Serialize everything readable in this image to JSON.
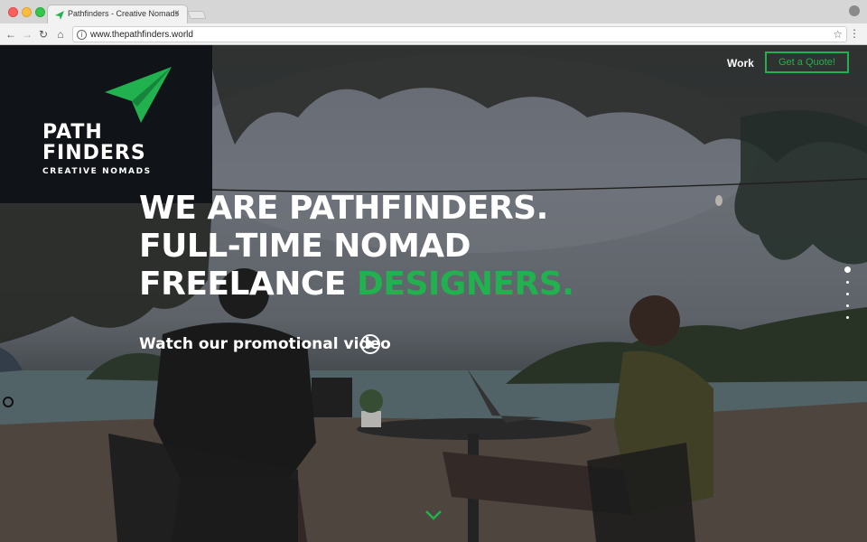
{
  "browser": {
    "tab_title": "Pathfinders - Creative Nomads",
    "tab_close": "×",
    "url": "www.thepathfinders.world",
    "back_icon": "back-arrow-icon",
    "forward_icon": "forward-arrow-icon",
    "reload_icon": "reload-icon",
    "home_icon": "home-icon",
    "star_icon": "star-icon",
    "menu_icon": "menu-dots-icon"
  },
  "logo": {
    "line1": "PATH",
    "line2": "FINDERS",
    "line3": "CREATIVE NOMADS"
  },
  "nav": {
    "work": "Work",
    "quote": "Get a Quote!"
  },
  "hero": {
    "line1": "WE ARE PATHFINDERS.",
    "line2": "FULL-TIME NOMAD",
    "line3_plain": "FREELANCE ",
    "line3_accent": "DESIGNERS.",
    "video_link": "Watch our promotional video"
  },
  "slider": {
    "count": 5,
    "active_index": 0
  },
  "colors": {
    "accent": "#21b14f",
    "logo_bg": "#101418"
  }
}
